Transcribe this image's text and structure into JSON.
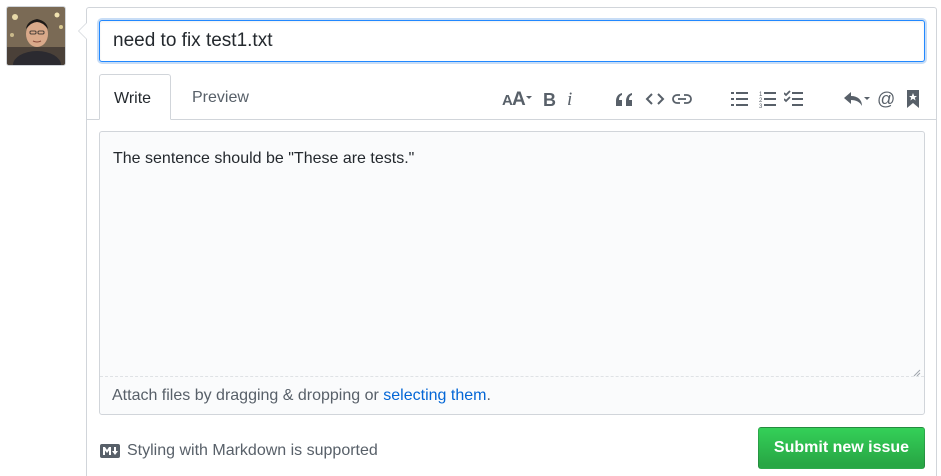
{
  "issue_form": {
    "title_value": "need to fix test1.txt",
    "tabs": [
      {
        "label": "Write",
        "active": true
      },
      {
        "label": "Preview",
        "active": false
      }
    ],
    "toolbar": [
      {
        "name": "text-size-icon"
      },
      {
        "name": "bold-icon"
      },
      {
        "name": "italic-icon"
      },
      {
        "name": "quote-icon"
      },
      {
        "name": "code-icon"
      },
      {
        "name": "link-icon"
      },
      {
        "name": "unordered-list-icon"
      },
      {
        "name": "ordered-list-icon"
      },
      {
        "name": "task-list-icon"
      },
      {
        "name": "reply-icon"
      },
      {
        "name": "mention-icon"
      },
      {
        "name": "bookmark-icon"
      }
    ],
    "body_value": "The sentence should be \"These are tests.\"",
    "attach": {
      "prefix": "Attach files by dragging & dropping or ",
      "link": "selecting them",
      "suffix": "."
    },
    "markdown_note": "Styling with Markdown is supported",
    "submit_label": "Submit new issue"
  },
  "colors": {
    "accent_blue": "#0366d6",
    "submit_green": "#28a745",
    "border": "#d1d5da",
    "muted_text": "#586069"
  }
}
